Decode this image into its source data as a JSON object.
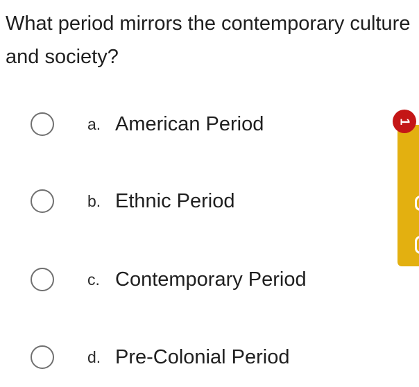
{
  "question": {
    "text": "What period mirrors the contemporary culture and society?"
  },
  "options": [
    {
      "letter": "a.",
      "label": "American Period"
    },
    {
      "letter": "b.",
      "label": "Ethnic Period"
    },
    {
      "letter": "c.",
      "label": "Contemporary Period"
    },
    {
      "letter": "d.",
      "label": "Pre-Colonial Period"
    }
  ],
  "side_panel": {
    "badge_text": "1",
    "badge_color": "#c41616",
    "tab_color": "#e3b010"
  }
}
